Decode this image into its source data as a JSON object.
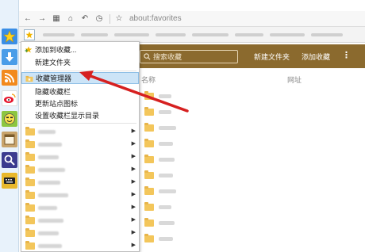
{
  "address_bar": {
    "url": "about:favorites"
  },
  "menu": {
    "items": [
      {
        "label": "添加到收藏..."
      },
      {
        "label": "新建文件夹"
      },
      {
        "label": "收藏管理器"
      },
      {
        "label": "隐藏收藏栏"
      },
      {
        "label": "更新站点图标"
      },
      {
        "label": "设置收藏栏显示目录"
      }
    ]
  },
  "favorites_page": {
    "search_placeholder": "搜索收藏",
    "new_folder_button": "新建文件夹",
    "add_favorite_button": "添加收藏",
    "more_button": "⋮",
    "columns": {
      "name": "名称",
      "url": "网址"
    }
  },
  "colors": {
    "header_bg": "#8b6a2e",
    "menu_highlight": "#cce4f7",
    "arrow": "#d62020",
    "folder": "#f3c65b"
  }
}
